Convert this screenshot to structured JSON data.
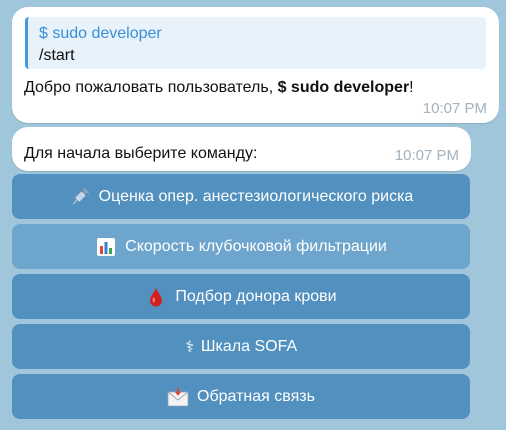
{
  "messages": [
    {
      "reply": {
        "author": "$ sudo developer",
        "text": "/start"
      },
      "text_before": "Добро пожаловать пользователь, ",
      "text_bold": "$ sudo developer",
      "text_after": "!",
      "time": "10:07 PM"
    },
    {
      "text": "Для начала выберите команду:",
      "time": "10:07 PM"
    }
  ],
  "keyboard": [
    {
      "icon": "syringe-icon",
      "label": "Оценка опер. анестезиологического риска"
    },
    {
      "icon": "bar-chart-icon",
      "label": "Скорость клубочковой фильтрации"
    },
    {
      "icon": "blood-drop-icon",
      "label": "Подбор донора крови"
    },
    {
      "icon": "medical-staff-icon",
      "glyph": "⚕",
      "label": "Шкала SOFA"
    },
    {
      "icon": "envelope-icon",
      "label": "Обратная связь"
    }
  ],
  "colors": {
    "background": "#9fc6da",
    "button": "#5190bf",
    "button_highlight": "#6ea5cc",
    "reply_accent": "#3f9ae1"
  }
}
